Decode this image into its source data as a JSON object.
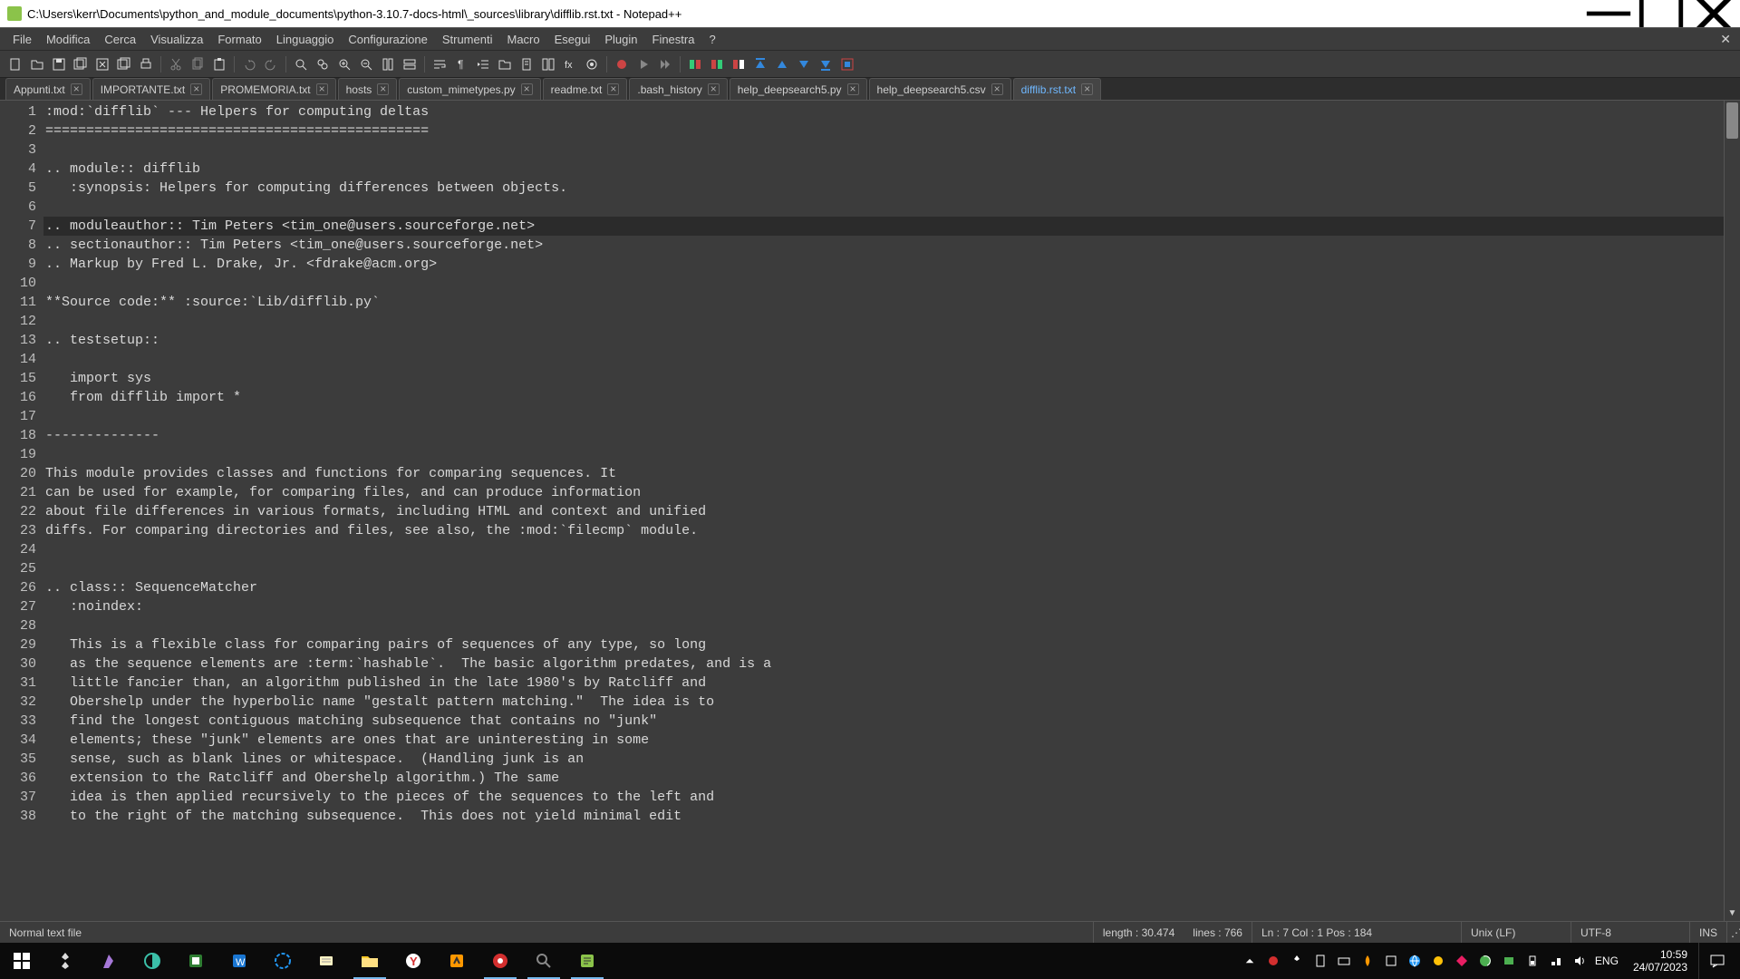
{
  "window": {
    "title": "C:\\Users\\kerr\\Documents\\python_and_module_documents\\python-3.10.7-docs-html\\_sources\\library\\difflib.rst.txt - Notepad++"
  },
  "menu": [
    "File",
    "Modifica",
    "Cerca",
    "Visualizza",
    "Formato",
    "Linguaggio",
    "Configurazione",
    "Strumenti",
    "Macro",
    "Esegui",
    "Plugin",
    "Finestra",
    "?"
  ],
  "tabs": [
    {
      "label": "Appunti.txt"
    },
    {
      "label": "IMPORTANTE.txt"
    },
    {
      "label": "PROMEMORIA.txt"
    },
    {
      "label": "hosts"
    },
    {
      "label": "custom_mimetypes.py"
    },
    {
      "label": "readme.txt"
    },
    {
      "label": ".bash_history"
    },
    {
      "label": "help_deepsearch5.py"
    },
    {
      "label": "help_deepsearch5.csv"
    },
    {
      "label": "difflib.rst.txt"
    }
  ],
  "active_tab_index": 9,
  "editor": {
    "first_line_number": 1,
    "current_line_index": 6,
    "lines": [
      ":mod:`difflib` --- Helpers for computing deltas",
      "===============================================",
      "",
      ".. module:: difflib",
      "   :synopsis: Helpers for computing differences between objects.",
      "",
      ".. moduleauthor:: Tim Peters <tim_one@users.sourceforge.net>",
      ".. sectionauthor:: Tim Peters <tim_one@users.sourceforge.net>",
      ".. Markup by Fred L. Drake, Jr. <fdrake@acm.org>",
      "",
      "**Source code:** :source:`Lib/difflib.py`",
      "",
      ".. testsetup::",
      "",
      "   import sys",
      "   from difflib import *",
      "",
      "--------------",
      "",
      "This module provides classes and functions for comparing sequences. It",
      "can be used for example, for comparing files, and can produce information",
      "about file differences in various formats, including HTML and context and unified",
      "diffs. For comparing directories and files, see also, the :mod:`filecmp` module.",
      "",
      "",
      ".. class:: SequenceMatcher",
      "   :noindex:",
      "",
      "   This is a flexible class for comparing pairs of sequences of any type, so long",
      "   as the sequence elements are :term:`hashable`.  The basic algorithm predates, and is a",
      "   little fancier than, an algorithm published in the late 1980's by Ratcliff and",
      "   Obershelp under the hyperbolic name \"gestalt pattern matching.\"  The idea is to",
      "   find the longest contiguous matching subsequence that contains no \"junk\"",
      "   elements; these \"junk\" elements are ones that are uninteresting in some",
      "   sense, such as blank lines or whitespace.  (Handling junk is an",
      "   extension to the Ratcliff and Obershelp algorithm.) The same",
      "   idea is then applied recursively to the pieces of the sequences to the left and",
      "   to the right of the matching subsequence.  This does not yield minimal edit"
    ]
  },
  "status": {
    "filetype": "Normal text file",
    "length_label": "length : 30.474",
    "lines_label": "lines : 766",
    "pos_label": "Ln : 7    Col : 1    Pos : 184",
    "eol": "Unix (LF)",
    "encoding": "UTF-8",
    "ins": "INS"
  },
  "tray": {
    "lang": "ENG",
    "time": "10:59",
    "date": "24/07/2023"
  }
}
